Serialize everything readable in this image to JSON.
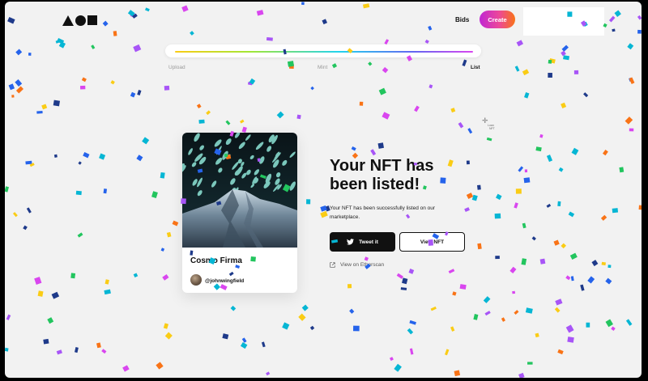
{
  "header": {
    "logo_name": "brand-logo-shapes",
    "nav": {
      "bids_label": "Bids"
    },
    "create_label": "Create"
  },
  "progress": {
    "steps": [
      {
        "label": "Upload",
        "active": false
      },
      {
        "label": "Mint",
        "active": false
      },
      {
        "label": "List",
        "active": true
      }
    ],
    "completed_fraction": 1.0
  },
  "nft": {
    "title": "Cosmo Firma",
    "creator": "@johnwingfield"
  },
  "main": {
    "headline": "Your NFT has been listed!",
    "description": "Your NFT has been successfully listed on our marketplace.",
    "tweet_label": "Tweet it",
    "view_label": "View NFT",
    "etherscan_label": "View on Etherscan"
  },
  "cursor_hint": {
    "line1": "Loan",
    "line2": "NFT"
  },
  "colors": {
    "background": "#f2f2f2",
    "create_gradient": [
      "#c026d3",
      "#ec4899",
      "#f97316"
    ],
    "primary_button": "#111111",
    "confetti": [
      "#2563eb",
      "#d946ef",
      "#22c55e",
      "#facc15",
      "#f97316",
      "#06b6d4",
      "#a855f7",
      "#1e3a8a"
    ]
  }
}
